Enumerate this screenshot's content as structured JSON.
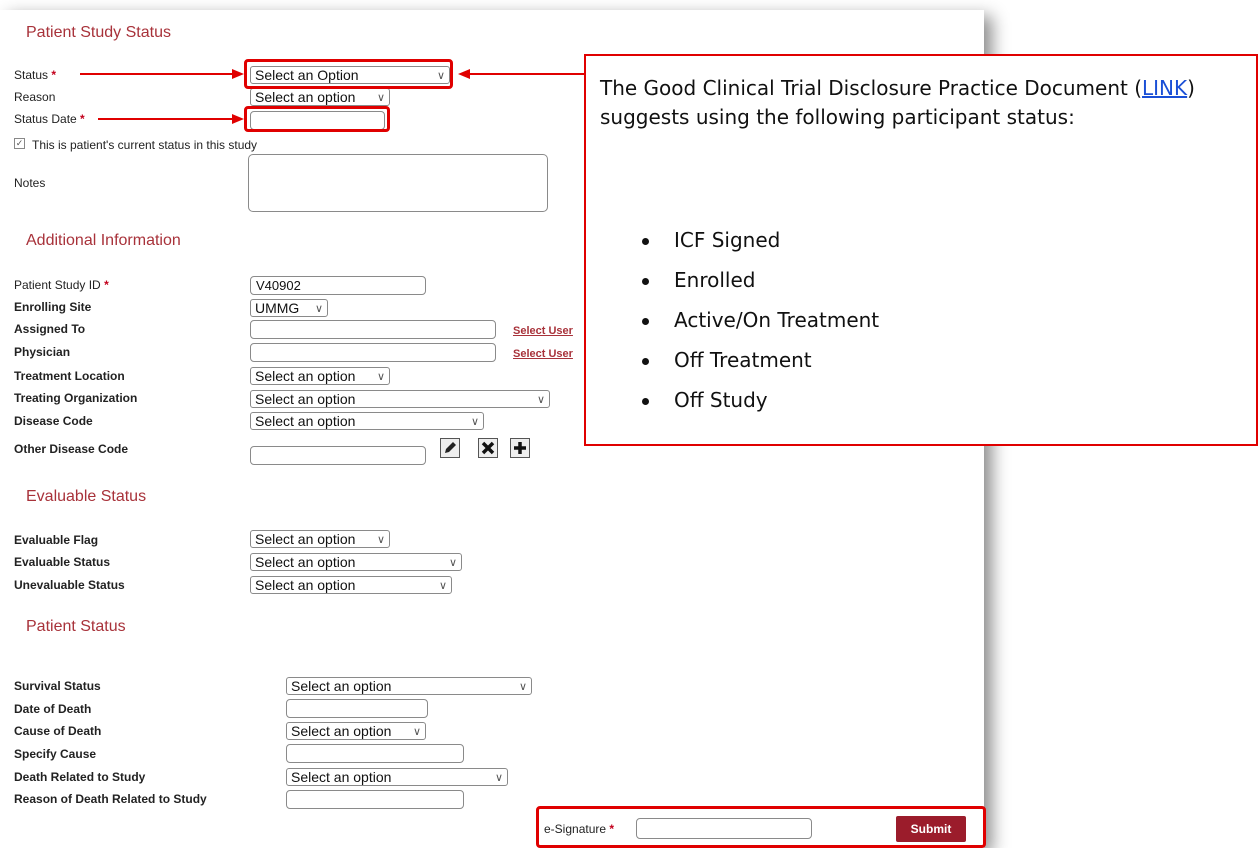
{
  "patient_study_status": {
    "header": "Patient Study Status",
    "status_label": "Status",
    "status_value": "Select an Option",
    "reason_label": "Reason",
    "reason_value": "Select an option",
    "status_date_label": "Status Date",
    "current_status_label": "This is patient's current status in this study",
    "notes_label": "Notes"
  },
  "required_mark": "*",
  "additional_information": {
    "header": "Additional Information",
    "patient_study_id_label": "Patient Study ID",
    "patient_study_id_value": "V40902",
    "enrolling_site_label": "Enrolling Site",
    "enrolling_site_value": "UMMG",
    "assigned_to_label": "Assigned To",
    "physician_label": "Physician",
    "select_user_link": "Select User",
    "treatment_location_label": "Treatment Location",
    "treatment_location_value": "Select an option",
    "treating_organization_label": "Treating Organization",
    "treating_organization_value": "Select an option",
    "disease_code_label": "Disease Code",
    "disease_code_value": "Select an option",
    "other_disease_code_label": "Other Disease Code"
  },
  "evaluable_status": {
    "header": "Evaluable Status",
    "evaluable_flag_label": "Evaluable Flag",
    "evaluable_flag_value": "Select an option",
    "evaluable_status_label": "Evaluable Status",
    "evaluable_status_value": "Select an option",
    "unevaluable_status_label": "Unevaluable Status",
    "unevaluable_status_value": "Select an option"
  },
  "patient_status": {
    "header": "Patient Status",
    "survival_status_label": "Survival Status",
    "survival_status_value": "Select an option",
    "date_of_death_label": "Date of Death",
    "cause_of_death_label": "Cause of Death",
    "cause_of_death_value": "Select an option",
    "specify_cause_label": "Specify Cause",
    "death_related_label": "Death Related to Study",
    "death_related_value": "Select an option",
    "reason_death_related_label": "Reason of Death Related to Study"
  },
  "signature": {
    "label": "e-Signature",
    "submit": "Submit"
  },
  "callout": {
    "text_before_link": "The Good Clinical Trial Disclosure Practice Document (",
    "link_text": "LINK",
    "text_after_link": ") suggests using the following participant status:",
    "items": [
      "ICF Signed",
      "Enrolled",
      "Active/On Treatment",
      "Off Treatment",
      "Off Study"
    ]
  },
  "icons": [
    "pencil-icon",
    "close-icon",
    "plus-icon",
    "chevron-down-icon",
    "checkbox-icon"
  ],
  "colors": {
    "accent": "#a8323a",
    "highlight": "#e00000",
    "submit": "#9b1c2b",
    "link": "#1a4fd6"
  }
}
